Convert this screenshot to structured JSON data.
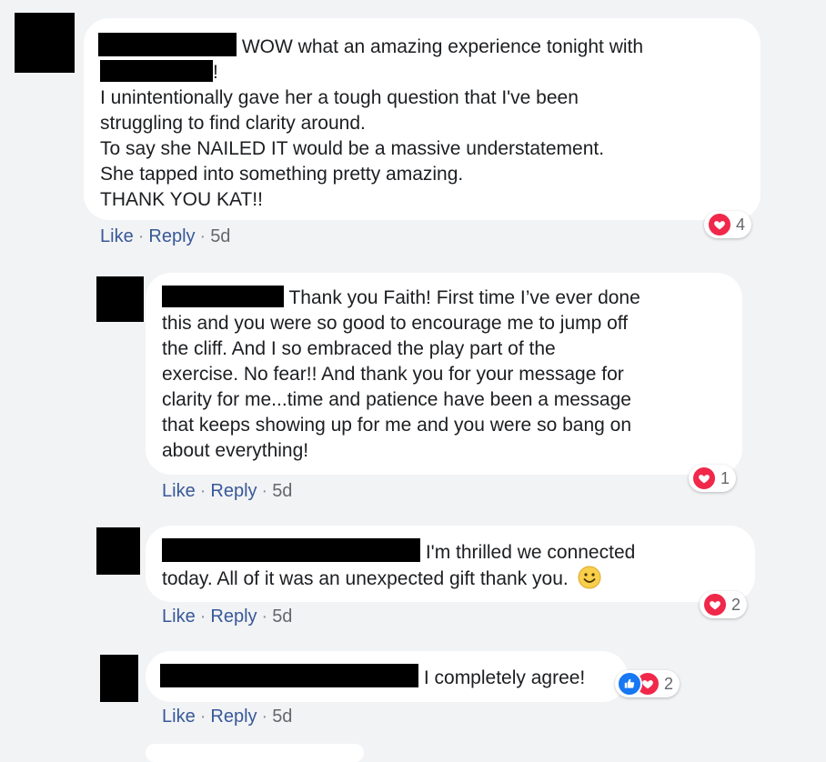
{
  "comments": [
    {
      "lines": [
        "WOW what an amazing experience tonight with",
        "!",
        "I unintentionally gave her a tough question that I've been",
        "struggling to find clarity around.",
        "To say she NAILED IT would be a massive understatement.",
        "She tapped into something pretty amazing.",
        "THANK YOU KAT!!"
      ],
      "reaction_count": "4",
      "reaction_icon": "heart-icon",
      "like_label": "Like",
      "reply_label": "Reply",
      "time": "5d"
    },
    {
      "lines": [
        "Thank you Faith! First time I’ve ever done",
        "this and you were so good to encourage me to jump off",
        "the cliff. And I so embraced the play part of the",
        "exercise. No fear!! And thank you for your message for",
        "clarity for me...time and patience have been a message",
        "that keeps showing up for me and you were so bang on",
        "about everything!"
      ],
      "reaction_count": "1",
      "reaction_icon": "heart-icon",
      "like_label": "Like",
      "reply_label": "Reply",
      "time": "5d"
    },
    {
      "lines": [
        "I'm thrilled we connected",
        "today. All of it was an unexpected gift thank you."
      ],
      "emoji": "smile-emoji",
      "reaction_count": "2",
      "reaction_icon": "heart-icon",
      "like_label": "Like",
      "reply_label": "Reply",
      "time": "5d"
    },
    {
      "lines": [
        "I completely agree!"
      ],
      "reaction_count": "2",
      "reaction_icons": [
        "like-icon",
        "heart-icon"
      ],
      "like_label": "Like",
      "reply_label": "Reply",
      "time": "5d"
    }
  ],
  "separator": "·",
  "colors": {
    "link": "#385898",
    "heart": "#f0284a",
    "like": "#1877f2",
    "bubble": "#ffffff",
    "background": "#f2f3f5"
  }
}
